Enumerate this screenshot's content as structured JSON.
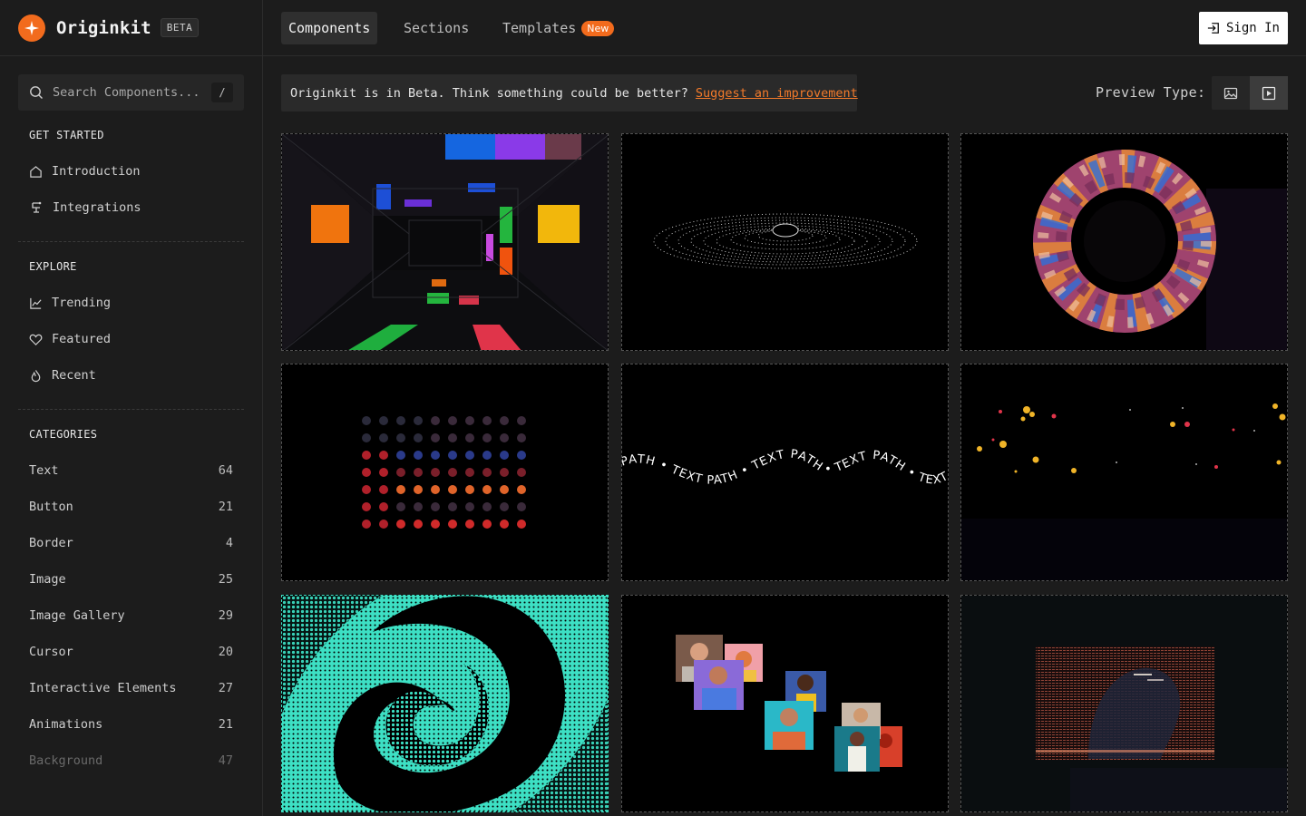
{
  "brand": {
    "name": "Originkit",
    "badge": "BETA"
  },
  "search": {
    "placeholder": "Search Components...",
    "shortcut": "/"
  },
  "sidebar": {
    "get_started": {
      "title": "GET STARTED",
      "items": [
        {
          "label": "Introduction",
          "icon": "home-icon"
        },
        {
          "label": "Integrations",
          "icon": "integrations-icon"
        }
      ]
    },
    "explore": {
      "title": "EXPLORE",
      "items": [
        {
          "label": "Trending",
          "icon": "trending-icon"
        },
        {
          "label": "Featured",
          "icon": "heart-icon"
        },
        {
          "label": "Recent",
          "icon": "flame-icon"
        }
      ]
    },
    "categories": {
      "title": "CATEGORIES",
      "items": [
        {
          "label": "Text",
          "count": "64"
        },
        {
          "label": "Button",
          "count": "21"
        },
        {
          "label": "Border",
          "count": "4"
        },
        {
          "label": "Image",
          "count": "25"
        },
        {
          "label": "Image Gallery",
          "count": "29"
        },
        {
          "label": "Cursor",
          "count": "20"
        },
        {
          "label": "Interactive Elements",
          "count": "27"
        },
        {
          "label": "Animations",
          "count": "21"
        },
        {
          "label": "Background",
          "count": "47"
        }
      ]
    }
  },
  "topnav": {
    "tabs": [
      {
        "label": "Components",
        "active": true
      },
      {
        "label": "Sections"
      },
      {
        "label": "Templates",
        "badge": "New"
      }
    ],
    "sign_in": "Sign In"
  },
  "banner": {
    "text": "Originkit is in Beta. Think something could be better?",
    "link": "Suggest an improvement"
  },
  "preview": {
    "label": "Preview Type:",
    "options": [
      {
        "icon": "image-icon"
      },
      {
        "icon": "video-icon",
        "selected": true
      }
    ]
  },
  "cards": {
    "wave_text": "PATH • TEXT PATH • TEXT PATH • TEXT PATH • TEXT PATH • TEXT PATH"
  },
  "colors": {
    "accent": "#f26b1d",
    "background": "#1c1c1c",
    "panel": "#262626",
    "link": "#f27a2a",
    "teal": "#3de0c4"
  }
}
